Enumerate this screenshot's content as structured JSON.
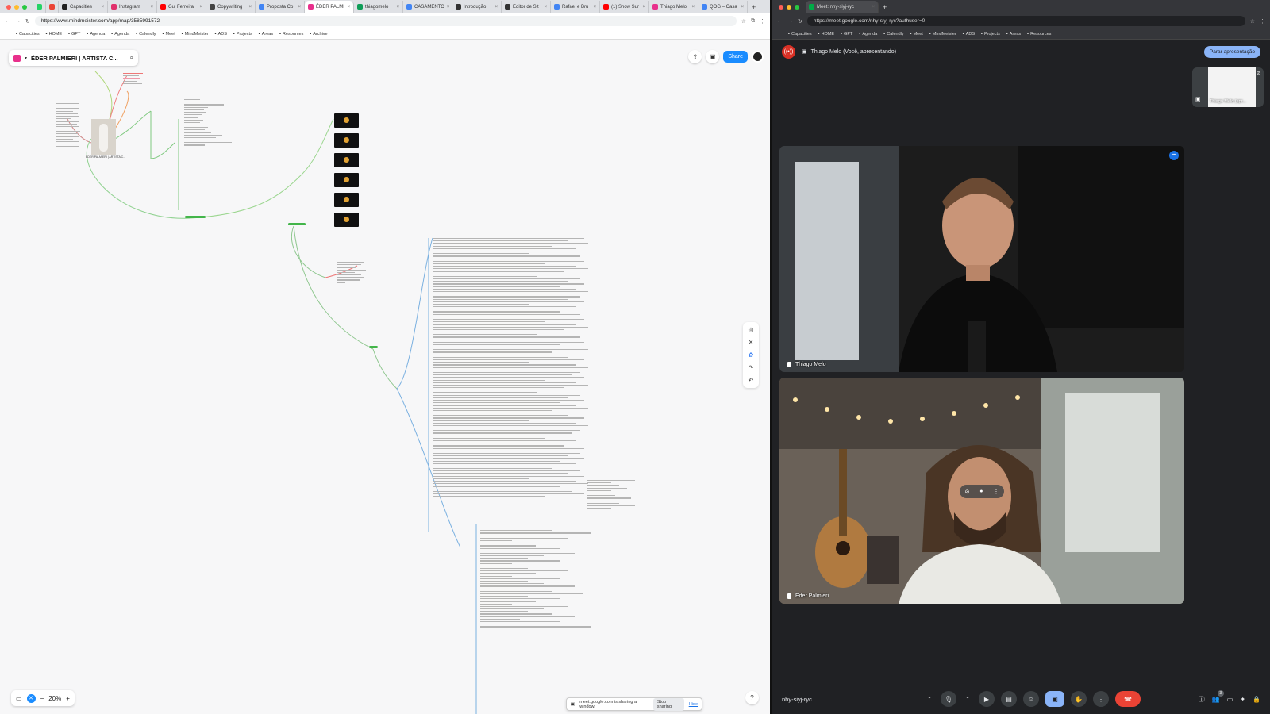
{
  "left_browser": {
    "tabs": [
      {
        "label": "",
        "color": "#25d366"
      },
      {
        "label": "",
        "color": "#ea4335"
      },
      {
        "label": "Capacities",
        "color": "#222222"
      },
      {
        "label": "Instagram",
        "color": "#e1306c"
      },
      {
        "label": "Gui Ferreira",
        "color": "#ff0000"
      },
      {
        "label": "Copywriting",
        "color": "#444444"
      },
      {
        "label": "Proposta Co",
        "color": "#4285f4"
      },
      {
        "label": "ÉDER PALMI",
        "color": "#e8308c",
        "active": true
      },
      {
        "label": "thiagomelo",
        "color": "#0f9d58"
      },
      {
        "label": "CASAMENTO",
        "color": "#4285f4"
      },
      {
        "label": "Introdução",
        "color": "#333333"
      },
      {
        "label": "Editor de Sit",
        "color": "#333333"
      },
      {
        "label": "Rafael e Bru",
        "color": "#4285f4"
      },
      {
        "label": "(1) Show Sur",
        "color": "#ff0000"
      },
      {
        "label": "Thiago Melo",
        "color": "#e8308c"
      },
      {
        "label": "QOG – Casa",
        "color": "#4285f4"
      }
    ],
    "url": "https://www.mindmeister.com/app/map/3585991572",
    "bookmarks": [
      "Capacities",
      "HOME",
      "GPT",
      "Agenda",
      "Agenda",
      "Calendly",
      "Meet",
      "MindMeister",
      "ADS",
      "Projects",
      "Areas",
      "Resources",
      "Archive"
    ]
  },
  "mindmap": {
    "title": "ÉDER PALMIERI | ARTISTA C...",
    "share_label": "Share",
    "zoom": "20%",
    "central_node_label": "ÉDER PALMIERI | ARTISTA C..."
  },
  "share_bar": {
    "message": "meet.google.com is sharing a window.",
    "stop_label": "Stop sharing",
    "hide_label": "Hide"
  },
  "right_browser": {
    "tab_label": "Meet: nhy-siyj-ryc",
    "url": "https://meet.google.com/nhy-siyj-ryc?authuser=0",
    "bookmarks": [
      "Capacities",
      "HOME",
      "GPT",
      "Agenda",
      "Calendly",
      "Meet",
      "MindMeister",
      "ADS",
      "Projects",
      "Areas",
      "Resources"
    ]
  },
  "meet": {
    "presenting_label": "Thiago Melo (Você, apresentando)",
    "stop_presenting_label": "Parar apresentação",
    "self_tile_label": "Thiago Melo (apr...",
    "participants": [
      {
        "name": "Thiago Melo"
      },
      {
        "name": "Eder Palmieri"
      }
    ],
    "meeting_code": "nhy-siyj-ryc",
    "people_count": "3"
  }
}
